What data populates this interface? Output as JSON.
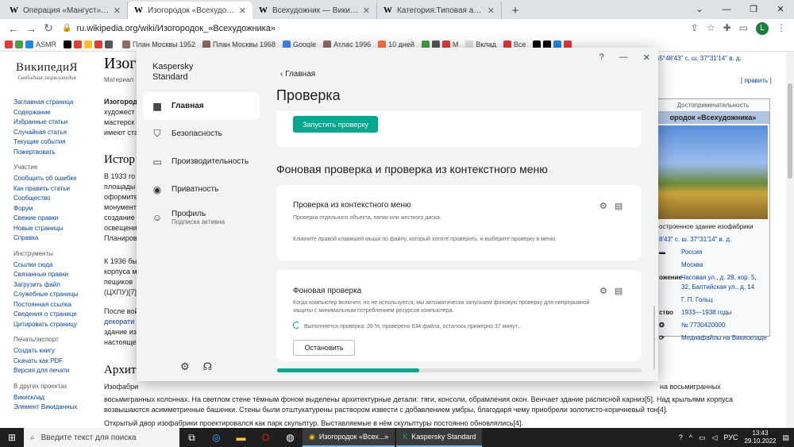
{
  "browser": {
    "tabs": [
      {
        "favicon": "W",
        "title": "Операция «Мангуст» — Википе",
        "active": false
      },
      {
        "favicon": "W",
        "title": "Изогородок «Всехудожника»",
        "active": true
      },
      {
        "favicon": "W",
        "title": "Всехудожник — Википедия",
        "active": false
      },
      {
        "favicon": "W",
        "title": "Категория:Типовая архитектура",
        "active": false
      }
    ],
    "new_tab": "+",
    "url": "ru.wikipedia.org/wiki/Изогородок_«Всехудожника»",
    "profile_initial": "L",
    "bookmarks": [
      "ASMR",
      "План Москвы 1952",
      "План Москвы 1968",
      "Google",
      "Атлас 1996",
      "10 дней",
      "М",
      "Вклад",
      "Все"
    ]
  },
  "wiki": {
    "logo_title": "ВикипедиЯ",
    "logo_subtitle": "Свободная энциклопедия",
    "title_partial": "Изог",
    "subtitle_partial": "Материал",
    "coords": "55°48′43″ с. ш. 37°31′14″ в. д.",
    "edit": "[ править ]",
    "sidebar": {
      "main": [
        "Заглавная страница",
        "Содержание",
        "Избранные статьи",
        "Случайная статья",
        "Текущие события",
        "Пожертвовать"
      ],
      "participation_heading": "Участие",
      "participation": [
        "Сообщить об ошибке",
        "Как править статьи",
        "Сообщество",
        "Форум",
        "Свежие правки",
        "Новые страницы",
        "Справка"
      ],
      "tools_heading": "Инструменты",
      "tools": [
        "Ссылки сюда",
        "Связанные правки",
        "Загрузить файл",
        "Служебные страницы",
        "Постоянная ссылка",
        "Сведения о странице",
        "Цитировать страницу"
      ],
      "print_heading": "Печать/экспорт",
      "print": [
        "Создать книгу",
        "Скачать как PDF",
        "Версия для печати"
      ],
      "other_heading": "В других проектах",
      "other": [
        "Викисклад",
        "Элемент Викиданных"
      ]
    },
    "body": {
      "lead_1": "Изогород",
      "lead_2": "художест",
      "lead_3": "мастерск",
      "lead_4": "имеют ста",
      "history_heading": "Истор",
      "p1": [
        "В 1933 го",
        "площады",
        "оформите",
        "монумент",
        "создание",
        "освещени",
        "Планиров"
      ],
      "p2": [
        "К 1936 бы",
        "корпуса м",
        "пещиков",
        "(ЦХПУ)[7]"
      ],
      "p3": [
        "После вой",
        "декорати",
        "здание из",
        "настояще"
      ],
      "arch_heading": "Архите",
      "arch_1": "Изофабри",
      "arch_right": "на восьмигранных",
      "arch_2": "восьмигранных колоннах. На светлом стене тёмным фоном выделены архитектурные детали: тяги, консоли, обрамления окон. Венчает здание расписной карниз[5]. Над крыльями корпуса",
      "arch_3": "возвышаются асимметричные башенки. Стены были отштукатурены раствором извести с добавлением умбры, благодаря чему приобрели золотисто-коричневый тон[4].",
      "arch_4": "Открытый двор изофабрики проектировался как парк скульптур. Выставляемые в нём скульптуры постоянно обновлялись[4]."
    },
    "infobox": {
      "caption": "Достопримечательность",
      "title": "ородок «Всехудожника»",
      "image_caption": "остроенное здание изофабрики",
      "coords": "8′43″ с. ш. 37°31′14″ в. д.",
      "country": "Россия",
      "city": "Москва",
      "address_key": "ожение",
      "address": "Часовая ул., д. 28, кор. 5, 32, Балтийская ул., д. 14",
      "architect": "Г. П. Гольц",
      "build_key": "ство",
      "build": "1933—1938 годы",
      "egrn": "№ 7730420000",
      "media": "Медиафайлы на Викискладе"
    }
  },
  "kaspersky": {
    "brand_line1": "Kaspersky",
    "brand_line2": "Standard",
    "nav": [
      {
        "icon": "grid-icon",
        "label": "Главная",
        "active": true
      },
      {
        "icon": "shield-icon",
        "label": "Безопасность",
        "active": false
      },
      {
        "icon": "monitor-icon",
        "label": "Производительность",
        "active": false
      },
      {
        "icon": "privacy-icon",
        "label": "Приватность",
        "active": false
      },
      {
        "icon": "profile-icon",
        "label": "Профиль",
        "sub": "Подписка активна",
        "active": false
      }
    ],
    "window_controls": [
      "?",
      "—",
      "✕"
    ],
    "back": "Главная",
    "page_title": "Проверка",
    "run_scan": "Запустить проверку",
    "section_title": "Фоновая проверка и проверка из контекстного меню",
    "context_card": {
      "title": "Проверка из контекстного меню",
      "desc": "Проверка отдельного объекта, папки или жесткого диска.",
      "hint": "Кликните правой клавишей мыши по файлу, который хотите проверить, и выберите проверку в меню."
    },
    "background_card": {
      "title": "Фоновая проверка",
      "desc_1": "Когда компьютер включен, но не используется, мы автоматически запускаем фоновую проверку для непрерывной",
      "desc_2": "защиты с минимальным потреблением ресурсов компьютера.",
      "status": "Выполняется проверка: 39 %, проверено 634 файла, осталось примерно 37 минут...",
      "stop": "Остановить"
    },
    "progress": 0.39
  },
  "taskbar": {
    "search_placeholder": "Введите текст для поиска",
    "apps": [
      {
        "label": "Изогородок «Всех...»"
      },
      {
        "label": "Kaspersky Standard"
      }
    ],
    "lang": "РУС",
    "time": "13:43",
    "date": "29.10.2022"
  }
}
